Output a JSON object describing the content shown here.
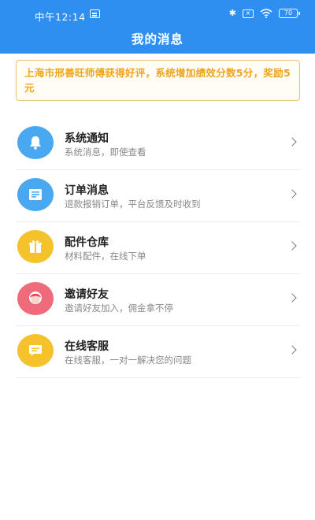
{
  "status_bar": {
    "time": "中午12:14",
    "bluetooth_icon": "bluetooth-icon",
    "sim_icon": "no-sim-icon",
    "wifi_icon": "wifi-icon",
    "battery": "70"
  },
  "header": {
    "title": "我的消息",
    "color": "#2f8ff0"
  },
  "notice": {
    "text": "上海市邢善旺师傅获得好评，系统增加绩效分数5分，奖励5元",
    "color": "#f0a418"
  },
  "messages": [
    {
      "title": "系统通知",
      "desc": "系统消息，即使查看",
      "icon": "bell-icon",
      "color": "#4aa8f0"
    },
    {
      "title": "订单消息",
      "desc": "退款报销订单，平台反馈及时收到",
      "icon": "order-document-icon",
      "color": "#4aa8f0"
    },
    {
      "title": "配件仓库",
      "desc": "材料配件，在线下单",
      "icon": "gift-box-icon",
      "color": "#f5c22b"
    },
    {
      "title": "邀请好友",
      "desc": "邀请好友加入，佣金拿不停",
      "icon": "friend-avatar-icon",
      "color": "#ef6a7b"
    },
    {
      "title": "在线客服",
      "desc": "在线客服，一对一解决您的问题",
      "icon": "chat-bubble-icon",
      "color": "#f5c22b"
    }
  ]
}
